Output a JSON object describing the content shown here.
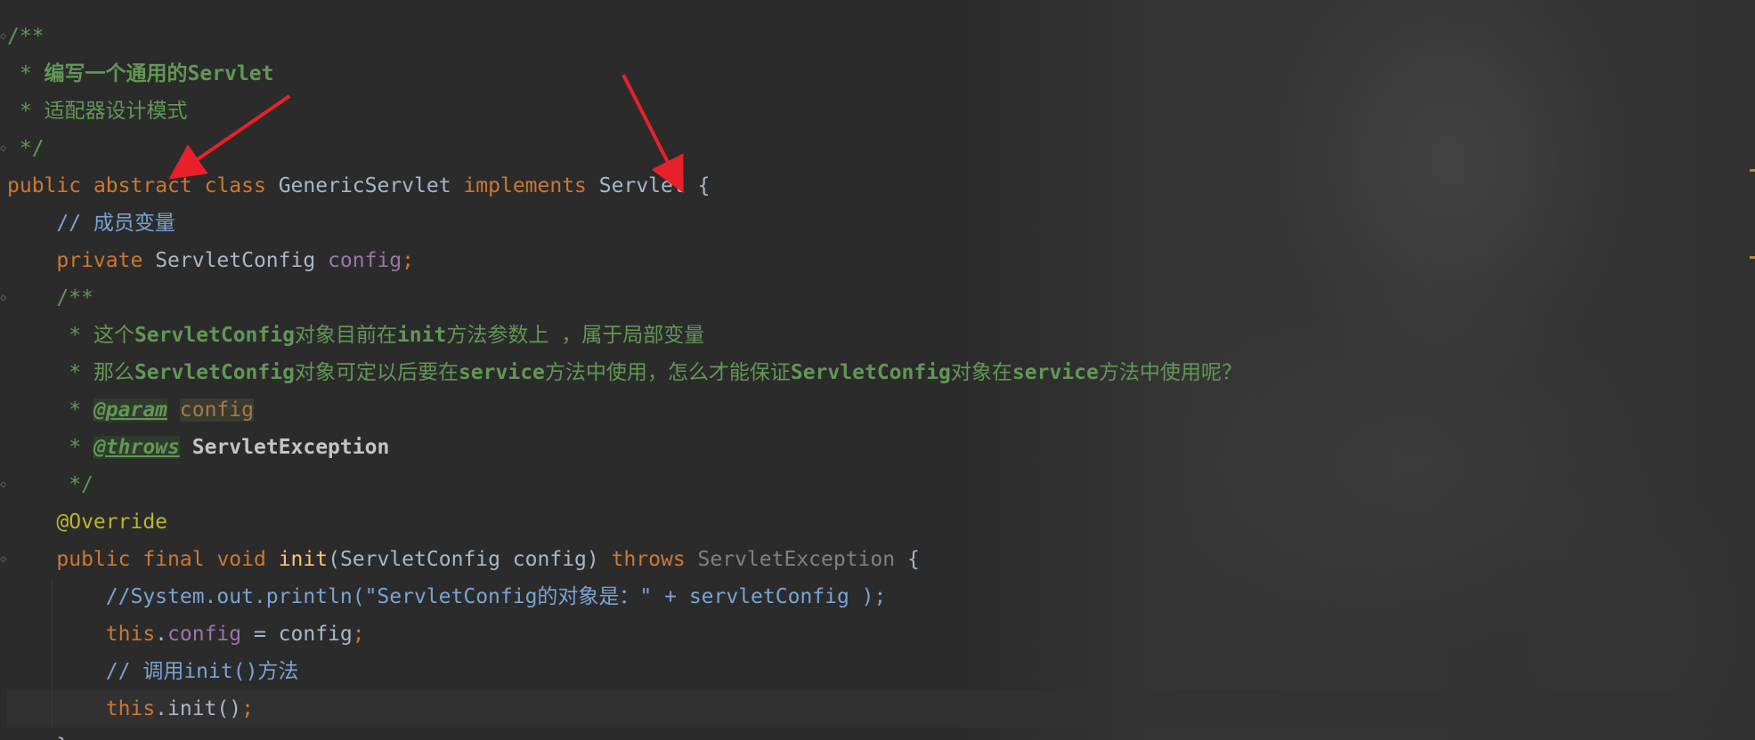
{
  "editor": {
    "language": "java",
    "current_line_index": 18,
    "colors": {
      "background": "#2b2b2b",
      "keyword": "#cc7832",
      "comment": "#629755",
      "field": "#9876aa",
      "annotation": "#bbb529",
      "function": "#ffc66d",
      "text": "#a9b7c6",
      "arrow": "#e8202a"
    }
  },
  "code": {
    "l1": "/**",
    "l2_star": " * ",
    "l2_text": "编写一个通用的Servlet",
    "l3_star": " * ",
    "l3_text": "适配器设计模式",
    "l4": " */",
    "l5_kw1": "public",
    "l5_kw2": "abstract",
    "l5_kw3": "class",
    "l5_name": "GenericServlet",
    "l5_kw4": "implements",
    "l5_iface": "Servlet",
    "l5_brace": "{",
    "l6": "// 成员变量",
    "l7_kw": "private",
    "l7_type": "ServletConfig",
    "l7_field": "config",
    "l7_semi": ";",
    "l8": "/**",
    "l9_star": " * ",
    "l9_text": "这个",
    "l9_b1": "ServletConfig",
    "l9_t2": "对象目前在",
    "l9_b2": "init",
    "l9_t3": "方法参数上 ，属于局部变量",
    "l10_star": " * ",
    "l10_t1": "那么",
    "l10_b1": "ServletConfig",
    "l10_t2": "对象可定以后要在",
    "l10_b2": "service",
    "l10_t3": "方法中使用，怎么才能保证",
    "l10_b3": "ServletConfig",
    "l10_t4": "对象在",
    "l10_b4": "service",
    "l10_t5": "方法中使用呢？",
    "l11_star": " * ",
    "l11_tag": "@param",
    "l11_ref": "config",
    "l12_star": " * ",
    "l12_tag": "@throws",
    "l12_ref": "ServletException",
    "l13": " */",
    "l14": "@Override",
    "l15_kw1": "public",
    "l15_kw2": "final",
    "l15_kw3": "void",
    "l15_fn": "init",
    "l15_params": "(ServletConfig config)",
    "l15_kw4": "throws",
    "l15_exc": "ServletException",
    "l15_brace": "{",
    "l16_a": "//System.out.println(\"ServletConfig的对象是：\" + servletConfig );",
    "l17_this": "this",
    "l17_dot": ".",
    "l17_field": "config",
    "l17_rest": " = config",
    "l17_semi": ";",
    "l18_a": "// 调用",
    "l18_b": "init()",
    "l18_c": "方法",
    "l19_this": "this",
    "l19_rest": ".init()",
    "l19_semi": ";",
    "l20": "}"
  },
  "annotations": [
    {
      "name": "arrow-to-abstract",
      "points_to": "abstract"
    },
    {
      "name": "arrow-to-servlet",
      "points_to": "Servlet"
    }
  ],
  "icons": [
    "fold-icon",
    "butterfly-icon",
    "arrow-annotation-icon"
  ]
}
